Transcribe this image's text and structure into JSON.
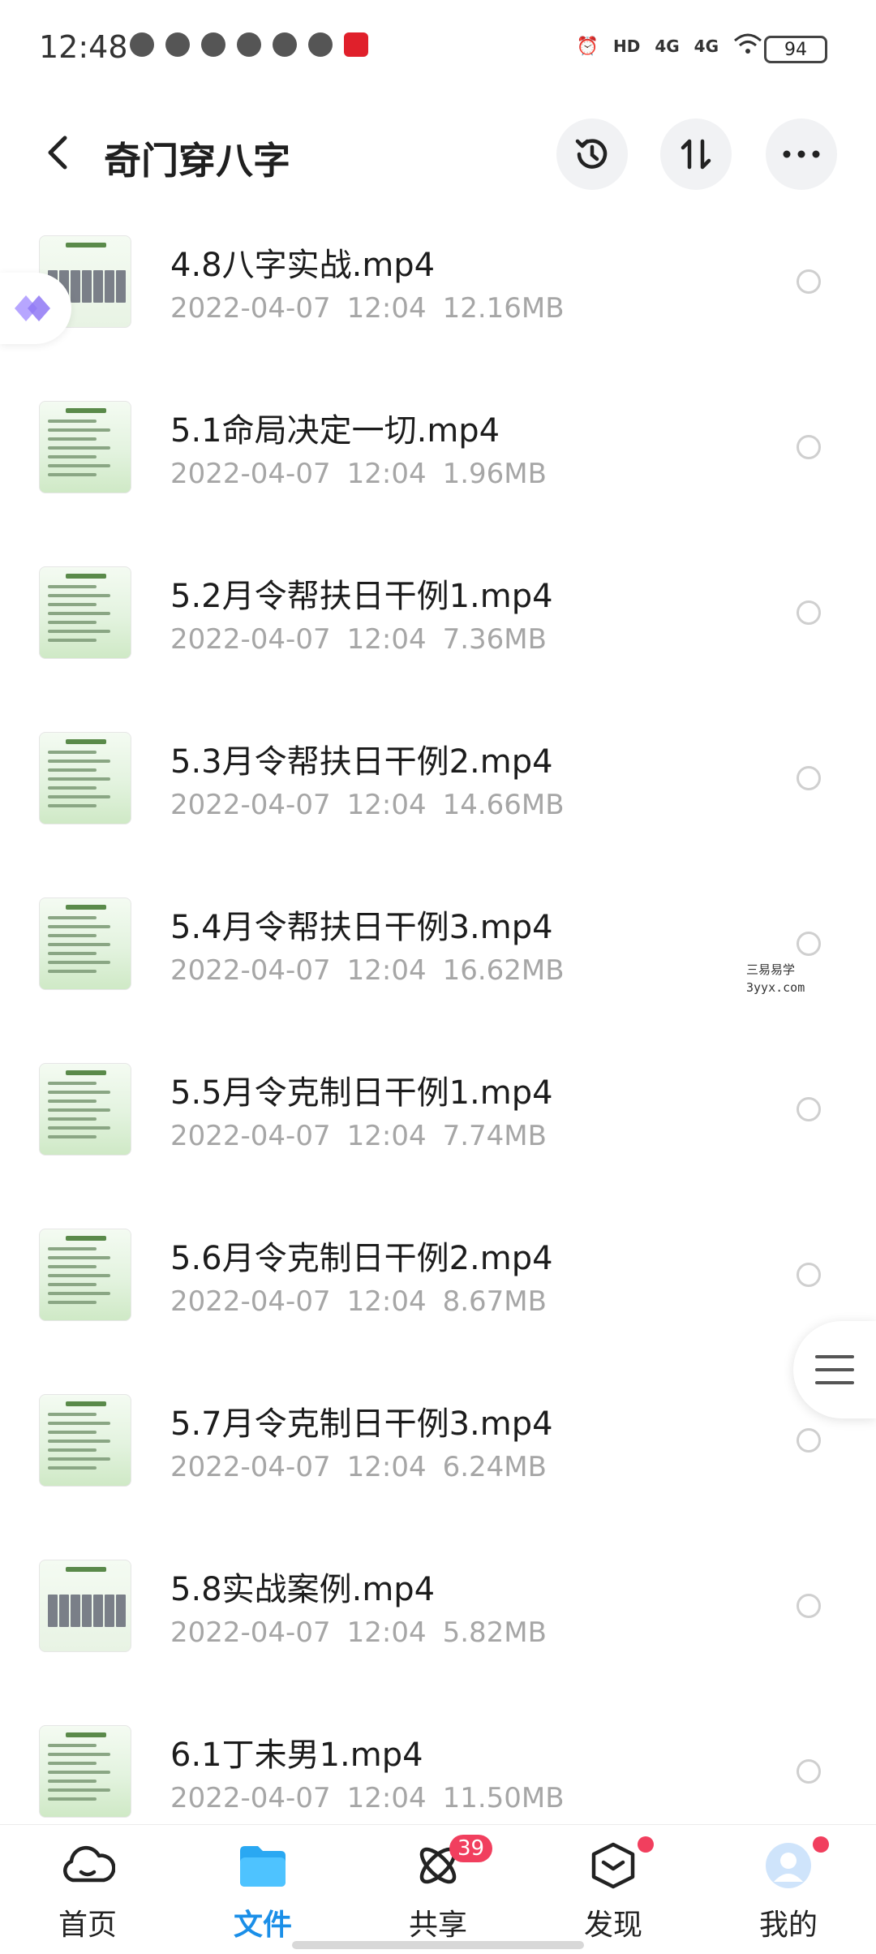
{
  "status_bar": {
    "time": "12:48",
    "network_a": "4G",
    "network_b": "4G",
    "hd": "HD",
    "battery": "94"
  },
  "header": {
    "title": "奇门穿八字"
  },
  "files": [
    {
      "name": "4.8八字实战.mp4",
      "date": "2022-04-07",
      "time": "12:04",
      "size": "12.16MB",
      "thumb": "grid"
    },
    {
      "name": "5.1命局决定一切.mp4",
      "date": "2022-04-07",
      "time": "12:04",
      "size": "1.96MB",
      "thumb": "text"
    },
    {
      "name": "5.2月令帮扶日干例1.mp4",
      "date": "2022-04-07",
      "time": "12:04",
      "size": "7.36MB",
      "thumb": "text"
    },
    {
      "name": "5.3月令帮扶日干例2.mp4",
      "date": "2022-04-07",
      "time": "12:04",
      "size": "14.66MB",
      "thumb": "text"
    },
    {
      "name": "5.4月令帮扶日干例3.mp4",
      "date": "2022-04-07",
      "time": "12:04",
      "size": "16.62MB",
      "thumb": "text"
    },
    {
      "name": "5.5月令克制日干例1.mp4",
      "date": "2022-04-07",
      "time": "12:04",
      "size": "7.74MB",
      "thumb": "text"
    },
    {
      "name": "5.6月令克制日干例2.mp4",
      "date": "2022-04-07",
      "time": "12:04",
      "size": "8.67MB",
      "thumb": "text"
    },
    {
      "name": "5.7月令克制日干例3.mp4",
      "date": "2022-04-07",
      "time": "12:04",
      "size": "6.24MB",
      "thumb": "text"
    },
    {
      "name": "5.8实战案例.mp4",
      "date": "2022-04-07",
      "time": "12:04",
      "size": "5.82MB",
      "thumb": "grid"
    },
    {
      "name": "6.1丁未男1.mp4",
      "date": "2022-04-07",
      "time": "12:04",
      "size": "11.50MB",
      "thumb": "text"
    }
  ],
  "watermark": {
    "line1": "三易易学",
    "line2": "3yyx.com"
  },
  "bottom_nav": {
    "home": "首页",
    "files": "文件",
    "share": "共享",
    "share_badge": "39",
    "discover": "发现",
    "mine": "我的"
  },
  "colors": {
    "accent": "#1b8fe8",
    "badge": "#f13f5e",
    "meta_text": "#a6a6a6"
  }
}
